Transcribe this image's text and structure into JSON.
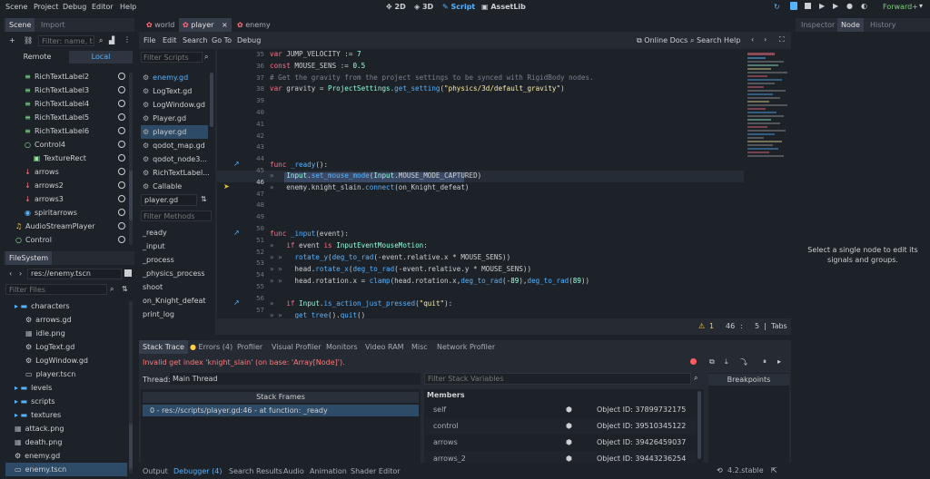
{
  "top_menu": [
    "Scene",
    "Project",
    "Debug",
    "Editor",
    "Help"
  ],
  "modes": {
    "m2d": "2D",
    "m3d": "3D",
    "script": "Script",
    "assetlib": "AssetLib"
  },
  "renderer": "Forward+",
  "scene_panel": {
    "tabs": [
      "Scene",
      "Import"
    ],
    "filter_placeholder": "Filter: name, t:t",
    "remote": "Remote",
    "local": "Local",
    "nodes": [
      {
        "label": "RichTextLabel2",
        "icon": "richtext-icon",
        "indent": 1
      },
      {
        "label": "RichTextLabel3",
        "icon": "richtext-icon",
        "indent": 1
      },
      {
        "label": "RichTextLabel4",
        "icon": "richtext-icon",
        "indent": 1
      },
      {
        "label": "RichTextLabel5",
        "icon": "richtext-icon",
        "indent": 1
      },
      {
        "label": "RichTextLabel6",
        "icon": "richtext-icon",
        "indent": 1
      },
      {
        "label": "Control4",
        "icon": "control-icon",
        "indent": 1
      },
      {
        "label": "TextureRect",
        "icon": "texture-icon",
        "indent": 2
      },
      {
        "label": "arrows",
        "icon": "arrow-icon",
        "indent": 1
      },
      {
        "label": "arrows2",
        "icon": "arrow-icon",
        "indent": 1
      },
      {
        "label": "arrows3",
        "icon": "arrow-icon",
        "indent": 1
      },
      {
        "label": "spiritarrows",
        "icon": "sprite-icon",
        "indent": 1
      },
      {
        "label": "AudioStreamPlayer",
        "icon": "audio-icon",
        "indent": 0
      },
      {
        "label": "Control",
        "icon": "control-icon",
        "indent": 0
      }
    ]
  },
  "filesystem": {
    "tab": "FileSystem",
    "path": "res://enemy.tscn",
    "filter_placeholder": "Filter Files",
    "items": [
      {
        "label": "characters",
        "type": "folder",
        "indent": 0
      },
      {
        "label": "arrows.gd",
        "type": "script",
        "indent": 1
      },
      {
        "label": "idle.png",
        "type": "image",
        "indent": 1
      },
      {
        "label": "LogText.gd",
        "type": "script",
        "indent": 1
      },
      {
        "label": "LogWindow.gd",
        "type": "script",
        "indent": 1
      },
      {
        "label": "player.tscn",
        "type": "scene",
        "indent": 1
      },
      {
        "label": "levels",
        "type": "folder",
        "indent": 0
      },
      {
        "label": "scripts",
        "type": "folder",
        "indent": 0
      },
      {
        "label": "textures",
        "type": "folder",
        "indent": 0
      },
      {
        "label": "attack.png",
        "type": "image",
        "indent": 0
      },
      {
        "label": "death.png",
        "type": "image",
        "indent": 0
      },
      {
        "label": "enemy.gd",
        "type": "script",
        "indent": 0
      },
      {
        "label": "enemy.tscn",
        "type": "scene",
        "indent": 0
      }
    ]
  },
  "editor_tabs": [
    "world",
    "player",
    "enemy"
  ],
  "script_menu": [
    "File",
    "Edit",
    "Search",
    "Go To",
    "Debug"
  ],
  "online_docs": "Online Docs",
  "search_help": "Search Help",
  "script_list": {
    "filter_placeholder": "Filter Scripts",
    "items": [
      "enemy.gd",
      "LogText.gd",
      "LogWindow.gd",
      "Player.gd",
      "player.gd",
      "qodot_map.gd",
      "qodot_node3...",
      "RichTextLabel...",
      "Callable"
    ],
    "current": "player.gd",
    "methods_placeholder": "Filter Methods",
    "methods": [
      "_ready",
      "_input",
      "_process",
      "_physics_process",
      "shoot",
      "on_Knight_defeat",
      "print_log"
    ]
  },
  "code": {
    "lines": [
      35,
      36,
      37,
      38,
      39,
      40,
      41,
      42,
      43,
      44,
      45,
      46,
      47,
      48,
      49,
      50,
      51,
      52,
      53,
      54,
      55,
      56,
      57
    ]
  },
  "status": {
    "warnings": "1",
    "line": "46",
    "col": "5",
    "indent": "Tabs"
  },
  "debugger": {
    "tabs": [
      "Stack Trace",
      "Errors (4)",
      "Profiler",
      "Visual Profiler",
      "Monitors",
      "Video RAM",
      "Misc",
      "Network Profiler"
    ],
    "error": "Invalid get index 'knight_slain' (on base: 'Array[Node]').",
    "thread_label": "Thread:",
    "thread_value": "Main Thread",
    "filter_vars": "Filter Stack Variables",
    "stack_frames_header": "Stack Frames",
    "frame": "0 - res://scripts/player.gd:46 - at function: _ready",
    "members_header": "Members",
    "members": [
      {
        "name": "self",
        "value": "Object ID: 37899732175"
      },
      {
        "name": "control",
        "value": "Object ID: 39510345122"
      },
      {
        "name": "arrows",
        "value": "Object ID: 39426459037"
      },
      {
        "name": "arrows_2",
        "value": "Object ID: 39443236254"
      }
    ],
    "breakpoints": "Breakpoints"
  },
  "bottom_tabs": [
    "Output",
    "Debugger (4)",
    "Search Results",
    "Audio",
    "Animation",
    "Shader Editor"
  ],
  "version": "4.2.stable",
  "inspector": {
    "tabs": [
      "Inspector",
      "Node",
      "History"
    ],
    "message": "Select a single node to edit its signals and groups."
  }
}
